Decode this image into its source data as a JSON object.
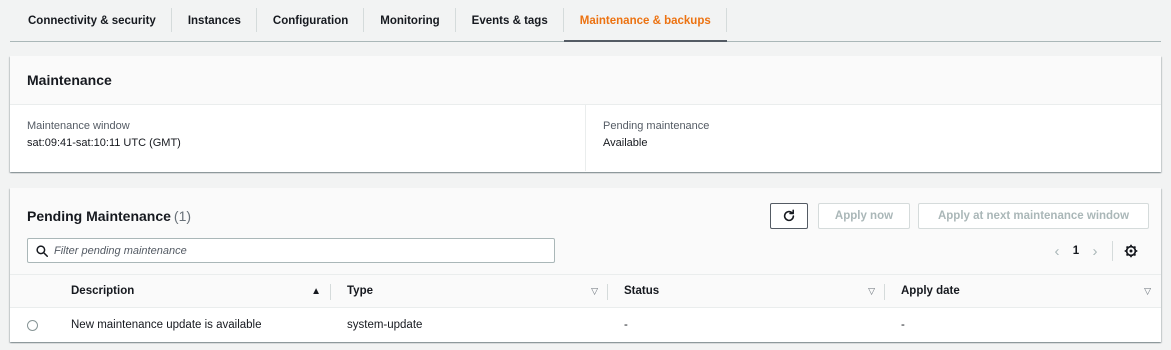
{
  "tabs": [
    {
      "label": "Connectivity & security",
      "active": false
    },
    {
      "label": "Instances",
      "active": false
    },
    {
      "label": "Configuration",
      "active": false
    },
    {
      "label": "Monitoring",
      "active": false
    },
    {
      "label": "Events & tags",
      "active": false
    },
    {
      "label": "Maintenance & backups",
      "active": true
    }
  ],
  "maintenance": {
    "title": "Maintenance",
    "window_label": "Maintenance window",
    "window_value": "sat:09:41-sat:10:11 UTC (GMT)",
    "pending_label": "Pending maintenance",
    "pending_value": "Available"
  },
  "pending": {
    "title": "Pending Maintenance",
    "count": "(1)",
    "refresh_icon": "refresh-icon",
    "apply_now_label": "Apply now",
    "apply_next_label": "Apply at next maintenance window",
    "filter_placeholder": "Filter pending maintenance",
    "page": "1",
    "columns": [
      "Description",
      "Type",
      "Status",
      "Apply date"
    ],
    "rows": [
      {
        "description": "New maintenance update is available",
        "type": "system-update",
        "status": "-",
        "apply_date": "-"
      }
    ]
  },
  "colors": {
    "accent": "#ec7211",
    "text": "#16191f",
    "border": "#aab7b8"
  }
}
